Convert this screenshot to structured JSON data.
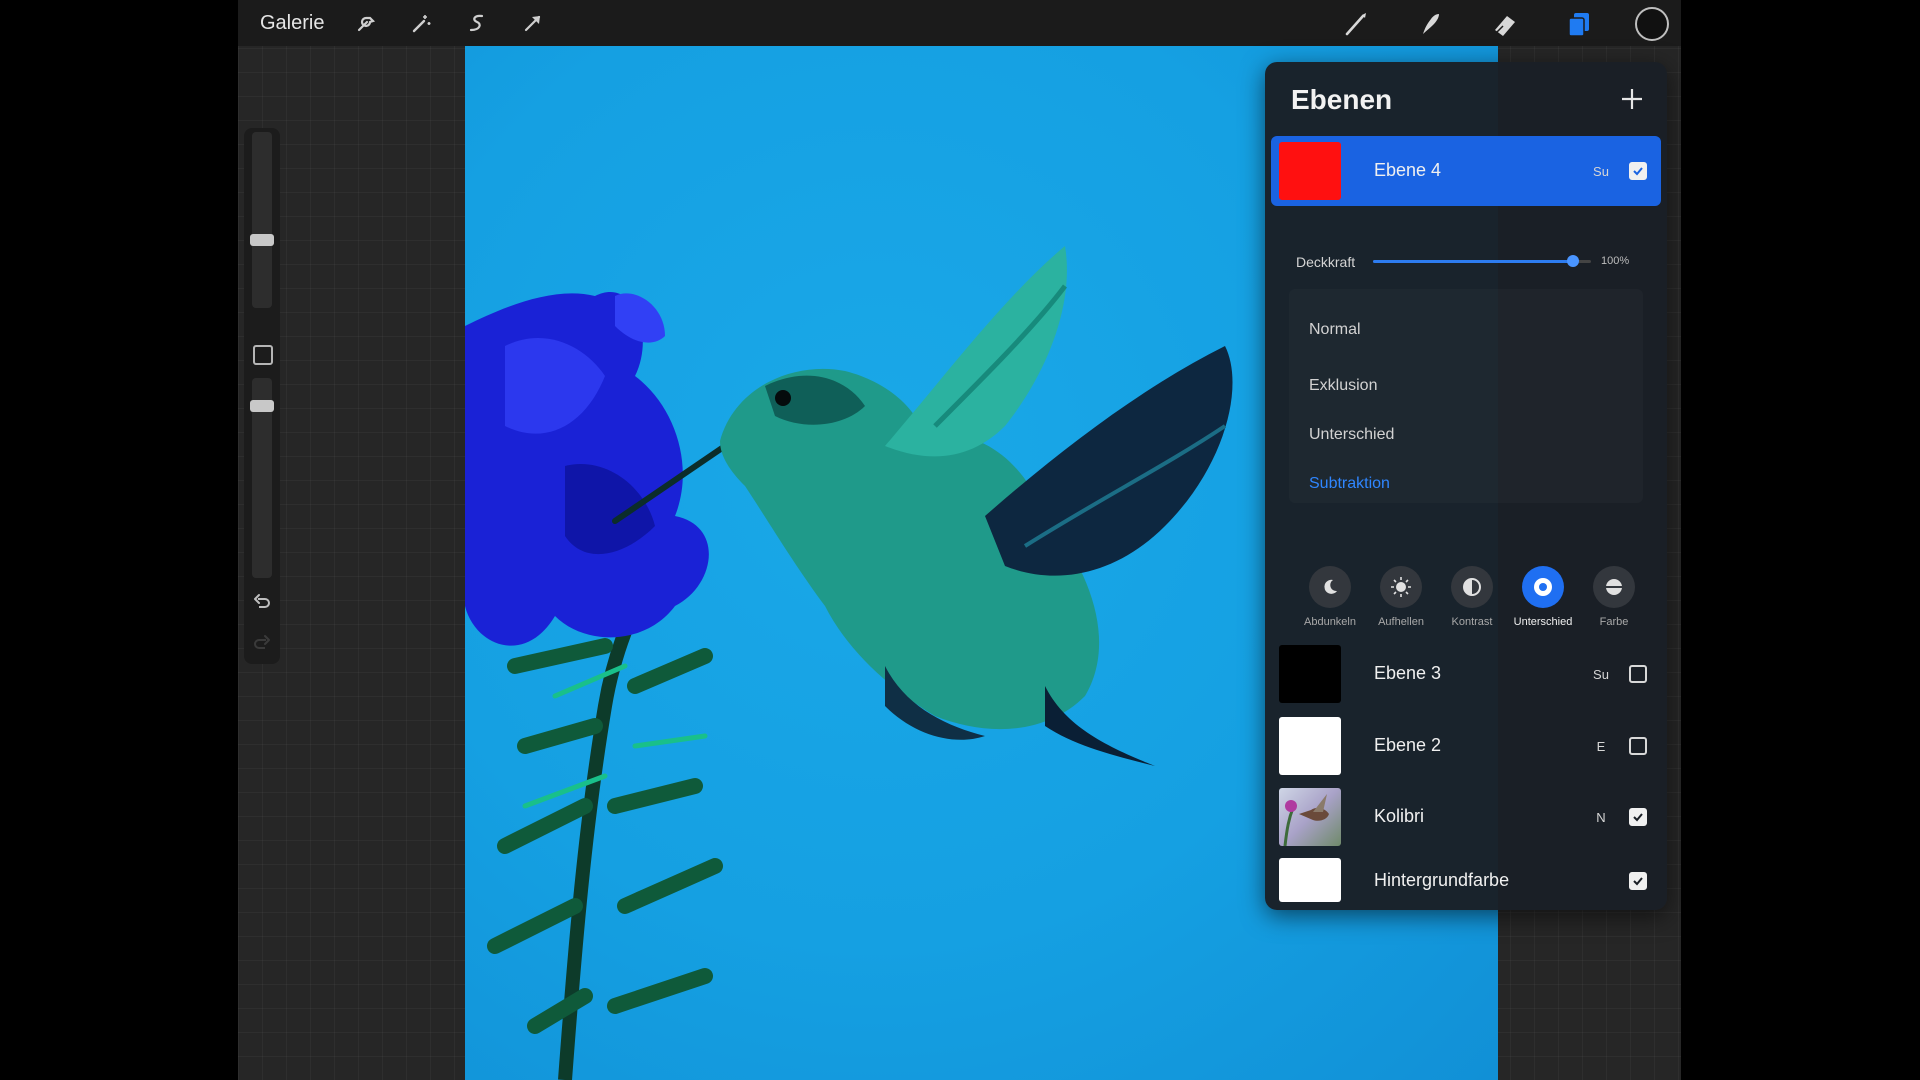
{
  "toolbar": {
    "gallery_label": "Galerie",
    "left_tools": [
      "wrench-icon",
      "magic-wand-icon",
      "selection-s-icon",
      "transform-arrow-icon"
    ],
    "right_tools": [
      "brush-icon",
      "smudge-icon",
      "eraser-icon",
      "layers-icon"
    ],
    "active_color": "#111111"
  },
  "layers_panel": {
    "title": "Ebenen",
    "add_icon": "plus-icon",
    "opacity": {
      "label": "Deckkraft",
      "value_text": "100%",
      "value": 1.0
    },
    "blend_modes": [
      "Normal",
      "Exklusion",
      "Unterschied",
      "Subtraktion"
    ],
    "selected_blend_mode": "Subtraktion",
    "categories": [
      {
        "label": "Abdunkeln",
        "icon": "moon-icon",
        "selected": false
      },
      {
        "label": "Aufhellen",
        "icon": "sun-icon",
        "selected": false
      },
      {
        "label": "Kontrast",
        "icon": "contrast-icon",
        "selected": false
      },
      {
        "label": "Unterschied",
        "icon": "difference-icon",
        "selected": true
      },
      {
        "label": "Farbe",
        "icon": "color-icon",
        "selected": false
      }
    ],
    "layers": [
      {
        "name": "Ebene 4",
        "mode": "Su",
        "visible": true,
        "thumb_color": "#ff1010",
        "active": true
      },
      {
        "name": "Ebene 3",
        "mode": "Su",
        "visible": false,
        "thumb_color": "#000000",
        "active": false
      },
      {
        "name": "Ebene 2",
        "mode": "E",
        "visible": false,
        "thumb_color": "#ffffff",
        "active": false
      },
      {
        "name": "Kolibri",
        "mode": "N",
        "visible": true,
        "thumb_color": "#7a6a8a",
        "active": false
      },
      {
        "name": "Hintergrundfarbe",
        "mode": "",
        "visible": true,
        "thumb_color": "#ffffff",
        "active": false
      }
    ]
  },
  "colors": {
    "accent": "#1a63e2",
    "canvas_sky": "#15a0e2",
    "flower": "#1a22d6",
    "bird": "#1f9a8a"
  }
}
